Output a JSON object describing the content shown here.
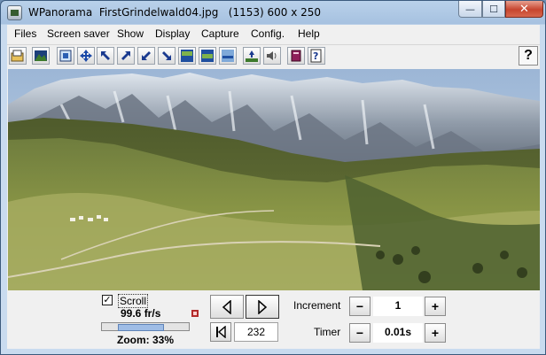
{
  "window": {
    "title": "WPanorama  FirstGrindelwald04.jpg   (1153) 600 x 250"
  },
  "caption_buttons": {
    "minimize": "—",
    "maximize": "☐",
    "close": "✕"
  },
  "menu": [
    "Files",
    "Screen saver",
    "Show",
    "Display",
    "Capture",
    "Config.",
    "Help"
  ],
  "toolbar": {
    "icons": [
      "open-folder-icon",
      "landscape-icon",
      "fit-window-icon",
      "move-arrows-icon",
      "arrow-up-left-icon",
      "arrow-up-right-icon",
      "arrow-down-left-icon",
      "arrow-down-right-icon",
      "view-top-icon",
      "view-middle-icon",
      "view-bottom-icon",
      "shrink-image-icon",
      "sound-icon",
      "book-icon",
      "help-page-icon"
    ],
    "help_label": "?"
  },
  "controls": {
    "scroll_label": "Scroll",
    "scroll_checked": "✓",
    "speed": "99.6 fr/s",
    "zoom": "Zoom: 33%",
    "zoom_level": 0.33,
    "frame": "232",
    "increment_label": "Increment",
    "increment_value": "1",
    "timer_label": "Timer",
    "timer_value": "0.01s",
    "minus": "−",
    "plus": "+"
  }
}
